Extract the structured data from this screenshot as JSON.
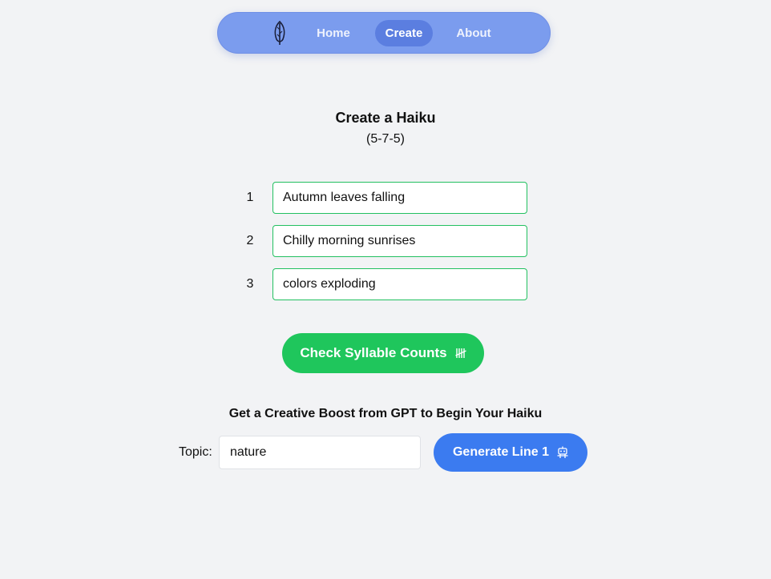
{
  "nav": {
    "logo_icon": "feather-icon",
    "links": [
      {
        "label": "Home",
        "active": false
      },
      {
        "label": "Create",
        "active": true
      },
      {
        "label": "About",
        "active": false
      }
    ],
    "background": "#7b9cee",
    "active_background": "#5b7ee0"
  },
  "main": {
    "title": "Create a Haiku",
    "subtitle": "(5-7-5)",
    "lines": [
      {
        "number": "1",
        "value": "Autumn leaves falling"
      },
      {
        "number": "2",
        "value": "Chilly morning sunrises"
      },
      {
        "number": "3",
        "value": "colors exploding"
      }
    ],
    "check_button": {
      "label": "Check Syllable Counts",
      "icon": "tally-marks-icon",
      "color": "#1fc65c"
    }
  },
  "boost": {
    "title": "Get a Creative Boost from GPT to Begin Your Haiku",
    "topic_label": "Topic:",
    "topic_value": "nature",
    "generate_button": {
      "label": "Generate Line 1",
      "icon": "robot-icon",
      "color": "#3b7bf0"
    }
  }
}
